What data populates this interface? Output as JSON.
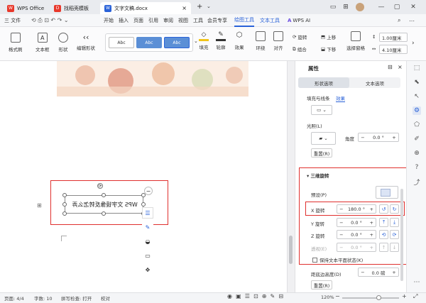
{
  "tabs": [
    {
      "label": "WPS Office",
      "icon": "wps-icon",
      "color": "#e8382b"
    },
    {
      "label": "找稻壳模板",
      "icon": "docer-icon",
      "color": "#e8382b"
    },
    {
      "label": "文字文稿.docx",
      "icon": "writer-icon",
      "color": "#2a62d8"
    }
  ],
  "menu": {
    "file": "三 文件",
    "items": [
      "开始",
      "插入",
      "页面",
      "引用",
      "审阅",
      "视图",
      "工具",
      "会员专享"
    ],
    "draw_tools": "绘图工具",
    "text_tools": "文本工具",
    "wps_ai": "WPS AI"
  },
  "toolbar": {
    "format_painter": "格式刷",
    "textbox": "文本框",
    "shape": "形状",
    "edit_shape": "编辑形状",
    "styles": [
      "Abc",
      "Abc",
      "Abc"
    ],
    "fill": "填充",
    "outline": "轮廓",
    "effect": "效果",
    "wrap": "环绕",
    "align": "对齐",
    "rotate": "旋转",
    "group": "组合",
    "bring_up": "上移",
    "send_down": "下移",
    "selection_pane": "选择窗格",
    "height": "1.00厘米",
    "width": "4.10厘米"
  },
  "document": {
    "textbox_text": "WPS 文字镜像反转怎么弄"
  },
  "panel": {
    "title": "属性",
    "tab_shape": "形状选项",
    "tab_text": "文本选项",
    "sub_fill": "填充与线条",
    "sub_effect": "效果",
    "lighting": "光照(L)",
    "angle_label": "角度",
    "angle_value": "0.0 °",
    "reset": "重置(R)",
    "section_3d": "三维旋转",
    "preset": "预设(P)",
    "x_label": "X 旋转",
    "x_value": "180.0 °",
    "y_label": "Y 旋转",
    "y_value": "0.0 °",
    "z_label": "Z 旋转",
    "z_value": "0.0 °",
    "perspective_label": "透视(E)",
    "perspective_value": "0.0 °",
    "keep_flat": "保持文本平面状态(K)",
    "distance_label": "距底边高度(D)",
    "distance_value": "0.0 磅",
    "reset2": "重置(R)"
  },
  "status": {
    "page": "页面: 4/4",
    "words": "字数: 10",
    "spell": "拼写检查: 打开",
    "proof": "校对",
    "zoom": "120%"
  },
  "colors": {
    "accent": "#2a62d8",
    "highlight": "#e0302e"
  }
}
